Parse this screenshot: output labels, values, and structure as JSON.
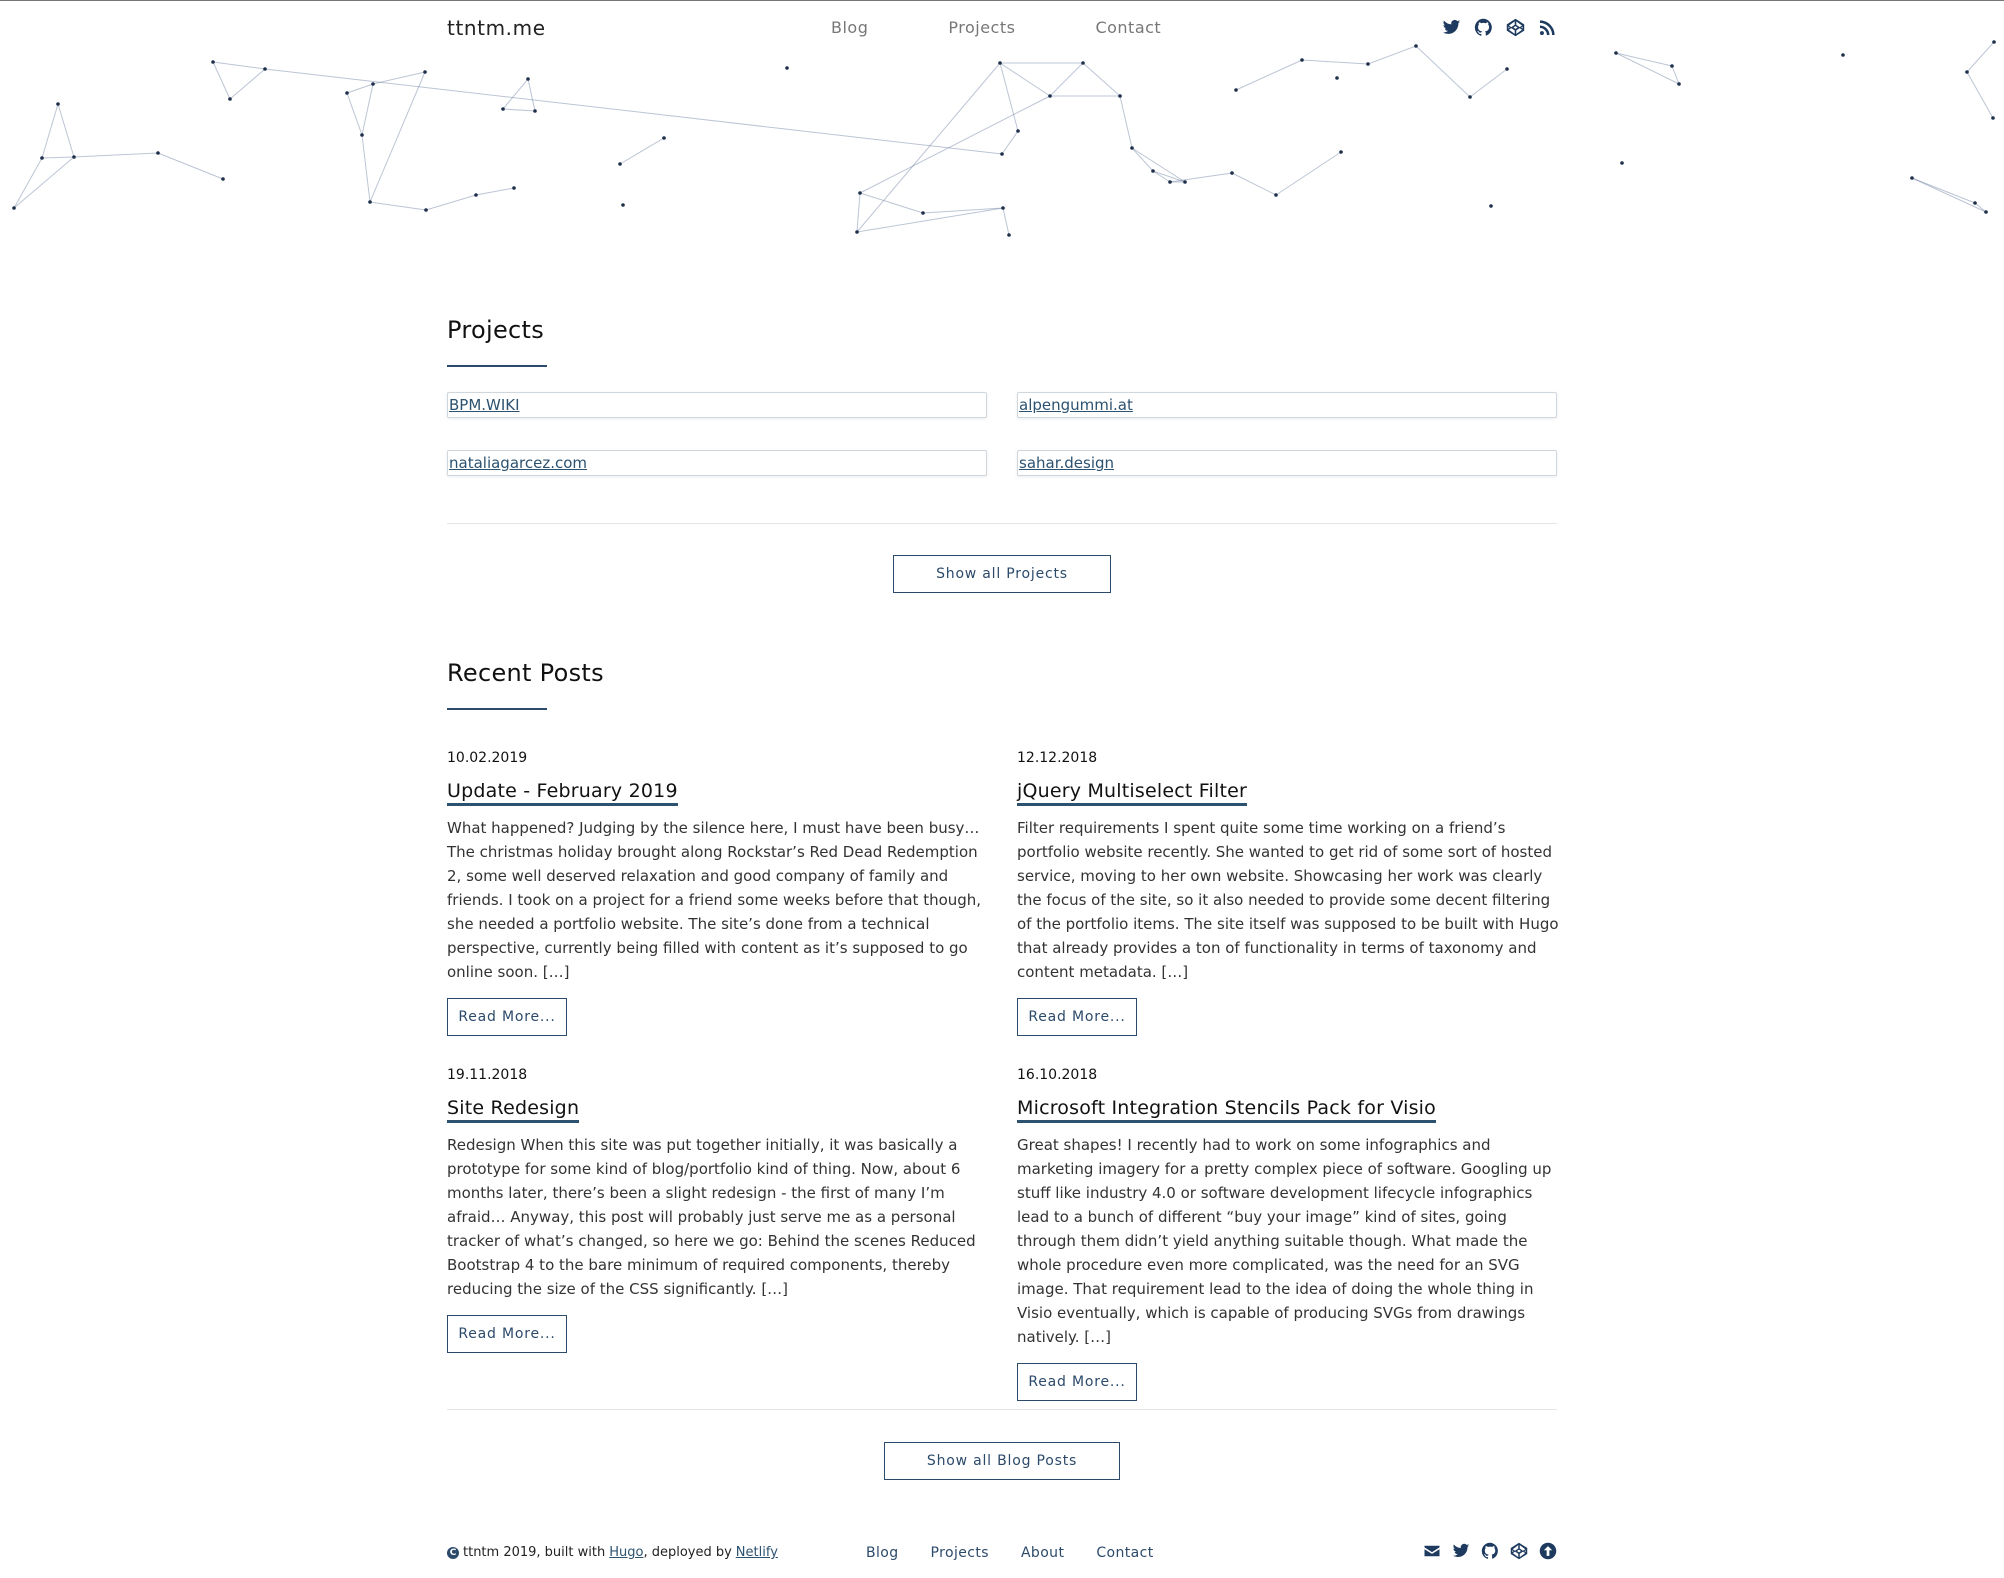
{
  "brand": "ttntm.me",
  "nav": [
    "Blog",
    "Projects",
    "Contact"
  ],
  "social_icons": [
    "twitter-icon",
    "github-icon",
    "codepen-icon",
    "rss-icon"
  ],
  "colors": {
    "accent": "#2c4a6a",
    "link": "#2c5270",
    "nav_text": "#777777",
    "particles": "#6b7fa0"
  },
  "projects": {
    "title": "Projects",
    "items": [
      "BPM.WIKI",
      "alpengummi.at",
      "nataliagarcez.com",
      "sahar.design"
    ],
    "show_all": "Show all Projects"
  },
  "recent": {
    "title": "Recent Posts",
    "read_more": "Read More...",
    "show_all": "Show all Blog Posts",
    "posts": [
      {
        "date": "10.02.2019",
        "title": "Update - February 2019",
        "excerpt": "What happened? Judging by the silence here, I must have been busy… The christmas holiday brought along Rockstar’s Red Dead Redemption 2, some well deserved relaxation and good company of family and friends. I took on a project for a friend some weeks before that though, she needed a portfolio website. The site’s done from a technical perspective, currently being filled with content as it’s supposed to go online soon. […]"
      },
      {
        "date": "12.12.2018",
        "title": "jQuery Multiselect Filter",
        "excerpt": "Filter requirements I spent quite some time working on a friend’s portfolio website recently. She wanted to get rid of some sort of hosted service, moving to her own website. Showcasing her work was clearly the focus of the site, so it also needed to provide some decent filtering of the portfolio items. The site itself was supposed to be built with Hugo that already provides a ton of functionality in terms of taxonomy and content metadata. […]"
      },
      {
        "date": "19.11.2018",
        "title": "Site Redesign",
        "excerpt": "Redesign When this site was put together initially, it was basically a prototype for some kind of blog/portfolio kind of thing. Now, about 6 months later, there’s been a slight redesign - the first of many I’m afraid… Anyway, this post will probably just serve me as a personal tracker of what’s changed, so here we go: Behind the scenes Reduced Bootstrap 4 to the bare minimum of required components, thereby reducing the size of the CSS significantly. […]"
      },
      {
        "date": "16.10.2018",
        "title": "Microsoft Integration Stencils Pack for Visio",
        "excerpt": "Great shapes! I recently had to work on some infographics and marketing imagery for a pretty complex piece of software. Googling up stuff like industry 4.0 or software development lifecycle infographics lead to a bunch of different “buy your image” kind of sites, going through them didn’t yield anything suitable though. What made the whole procedure even more complicated, was the need for an SVG image. That requirement lead to the idea of doing the whole thing in Visio eventually, which is capable of producing SVGs from drawings natively. […]"
      }
    ]
  },
  "footer": {
    "copyright": "ttntm 2019, built with",
    "hugo": "Hugo",
    "deployed": ", deployed by",
    "netlify": "Netlify",
    "nav": [
      "Blog",
      "Projects",
      "About",
      "Contact"
    ],
    "icons": [
      "envelope-icon",
      "twitter-icon",
      "github-icon",
      "codepen-icon",
      "arrow-up-icon"
    ]
  }
}
